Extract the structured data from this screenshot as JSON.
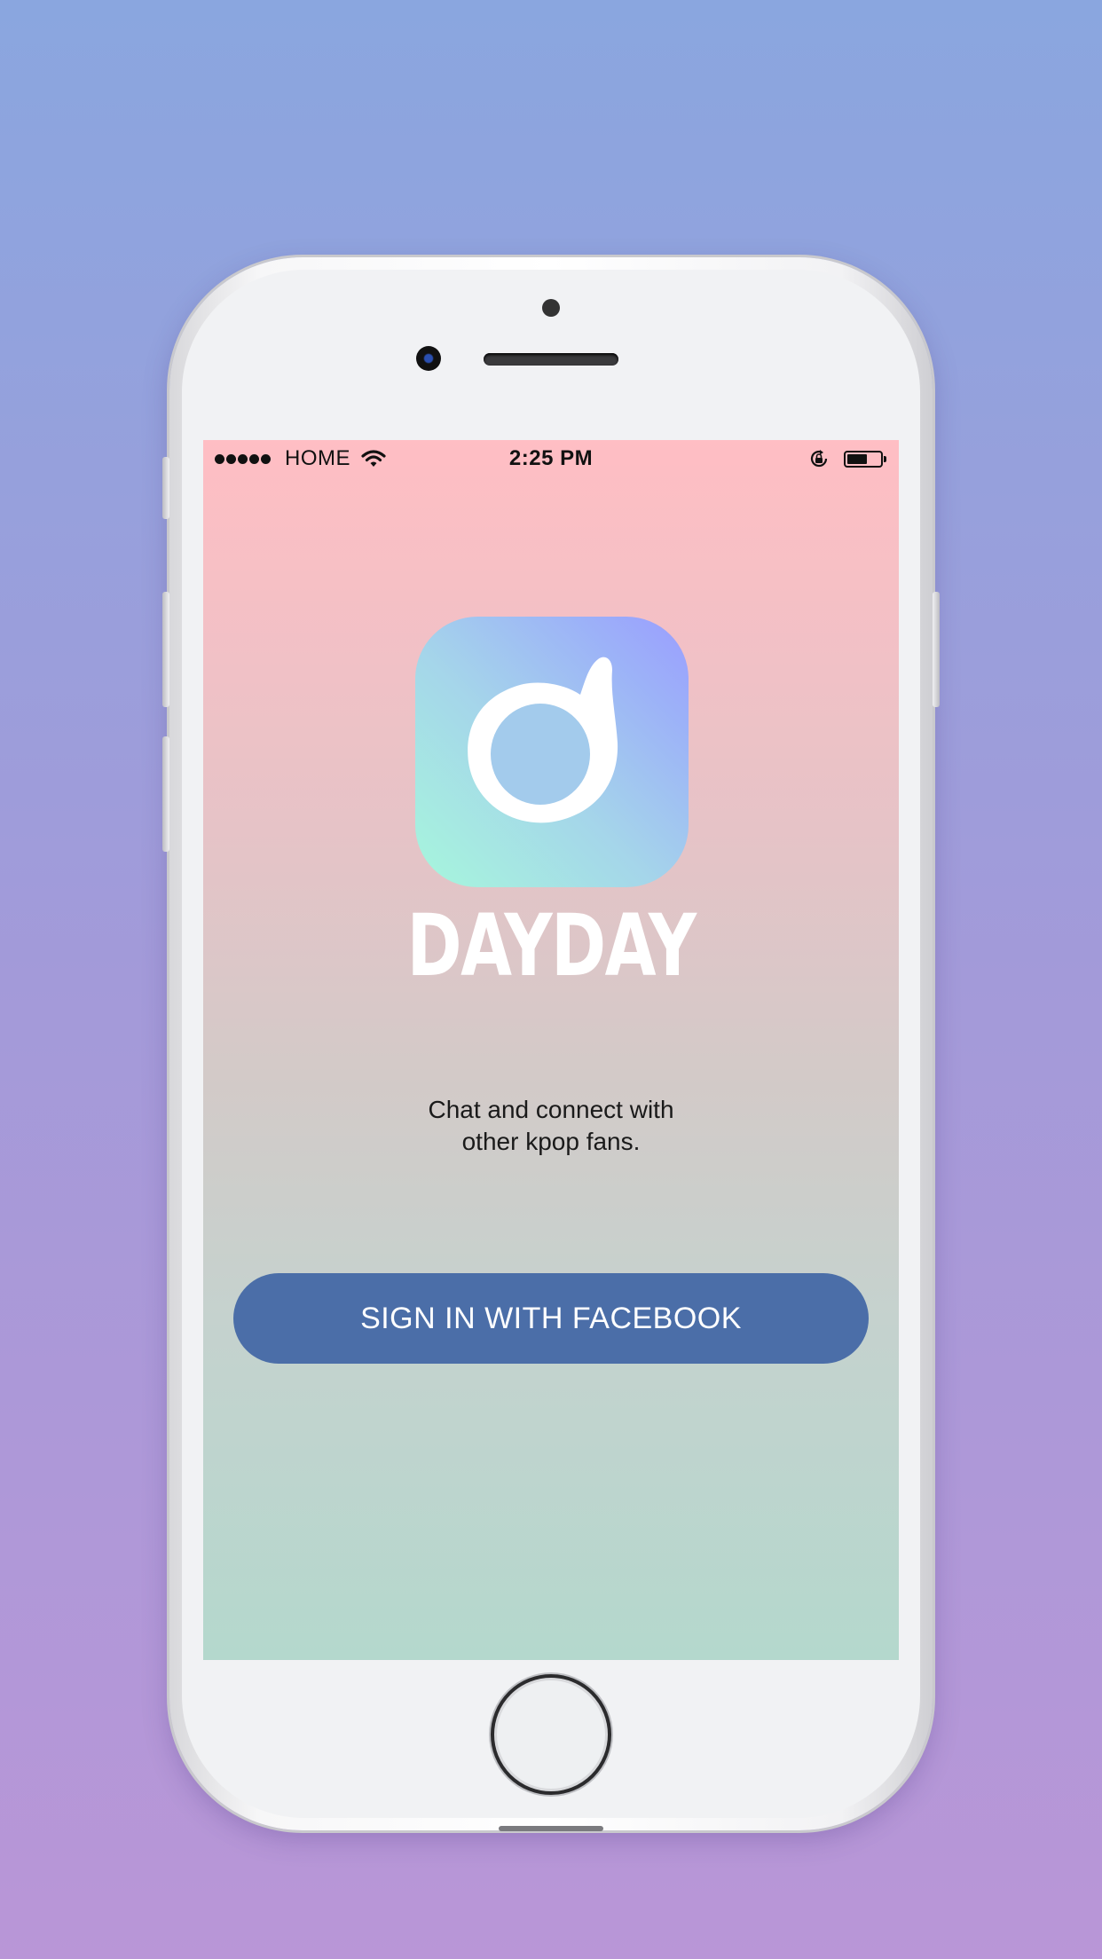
{
  "status_bar": {
    "carrier": "HOME",
    "time": "2:25 PM",
    "battery_level": 0.6,
    "signal_bars": 5
  },
  "app": {
    "name": "DAYDAY",
    "icon": "music-note-icon",
    "tagline_line1": "Chat and connect with",
    "tagline_line2": "other kpop fans.",
    "facebook_button_label": "SIGN IN WITH FACEBOOK",
    "facebook_button_color": "#4b6ea8"
  },
  "device": {
    "model": "iphone",
    "home_button_icon": "home-button"
  },
  "colors": {
    "screen_top": "#ffbec4",
    "screen_bottom": "#b4d8cd",
    "icon_gradient_start": "#a6f7dc",
    "icon_gradient_end": "#9a9dff"
  }
}
